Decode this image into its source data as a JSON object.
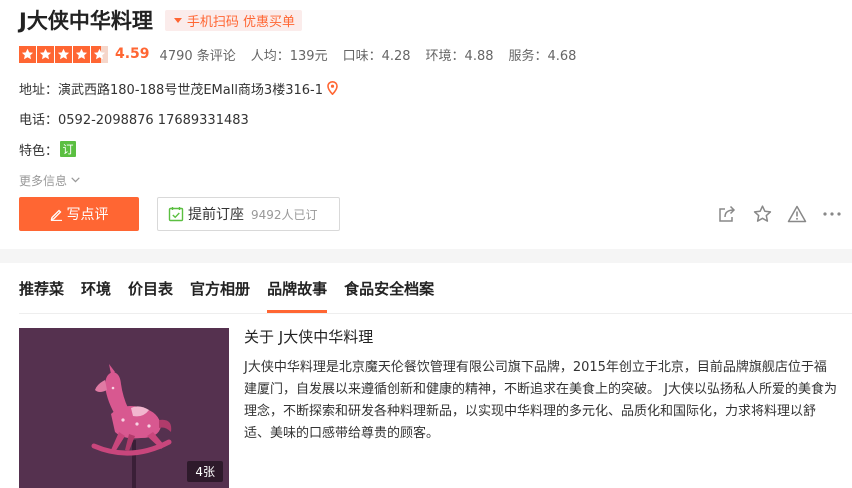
{
  "shop": {
    "name": "J大侠中华料理",
    "promo_label": "手机扫码 优惠买单"
  },
  "rating": {
    "stars": 4.5,
    "score": "4.59",
    "reviews": "4790 条评论",
    "per_capita": "人均：139元",
    "taste": "口味：4.28",
    "environment": "环境：4.88",
    "service": "服务：4.68"
  },
  "address": "地址：演武西路180-188号世茂EMall商场3楼316-1",
  "phone": "电话：0592-2098876 17689331483",
  "features": {
    "label": "特色：",
    "tag": "订"
  },
  "more_info": "更多信息",
  "buttons": {
    "write_review": "写点评",
    "reserve": "提前订座",
    "reserve_count": "9492人已订"
  },
  "icons": {
    "actions": [
      "share-icon",
      "star-icon",
      "report-icon",
      "more-icon"
    ]
  },
  "tabs": [
    {
      "label": "推荐菜",
      "active": false
    },
    {
      "label": "环境",
      "active": false
    },
    {
      "label": "价目表",
      "active": false
    },
    {
      "label": "官方相册",
      "active": false
    },
    {
      "label": "品牌故事",
      "active": true
    },
    {
      "label": "食品安全档案",
      "active": false
    }
  ],
  "brand_story": {
    "title": "关于 J大侠中华料理",
    "body": "J大侠中华料理是北京魔天伦餐饮管理有限公司旗下品牌，2015年创立于北京，目前品牌旗舰店位于福建厦门，自发展以来遵循创新和健康的精神，不断追求在美食上的突破。 J大侠以弘扬私人所爱的美食为理念，不断探索和研发各种料理新品，以实现中华料理的多元化、品质化和国际化，力求将料理以舒适、美味的口感带给尊贵的顾客。",
    "image_count": "4张"
  },
  "colors": {
    "accent": "#ff6633",
    "tag_green": "#5bbf41",
    "image_bg": "#55314f"
  }
}
